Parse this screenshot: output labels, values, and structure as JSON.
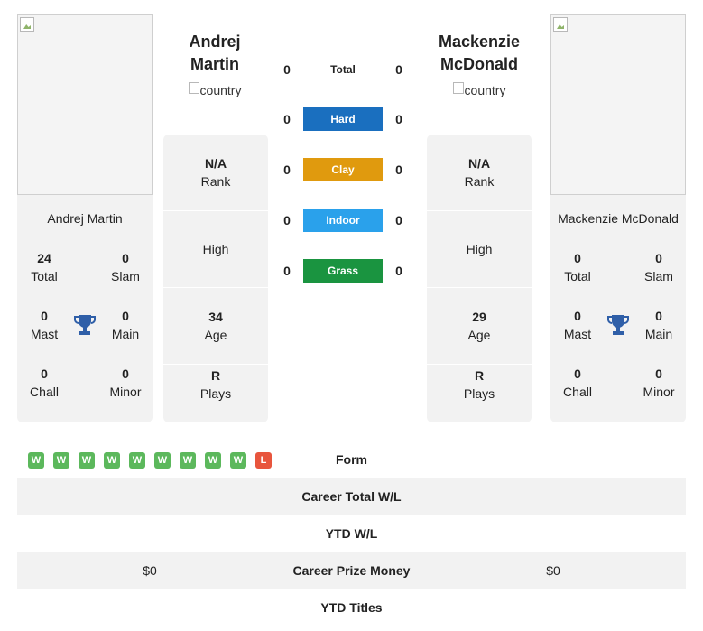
{
  "player1": {
    "name_line1": "Andrej",
    "name_line2": "Martin",
    "full_name": "Andrej Martin",
    "country_alt": "country",
    "stats": {
      "total": {
        "value": "24",
        "label": "Total"
      },
      "slam": {
        "value": "0",
        "label": "Slam"
      },
      "mast": {
        "value": "0",
        "label": "Mast"
      },
      "main": {
        "value": "0",
        "label": "Main"
      },
      "chall": {
        "value": "0",
        "label": "Chall"
      },
      "minor": {
        "value": "0",
        "label": "Minor"
      }
    },
    "rank": {
      "value": "N/A",
      "label": "Rank"
    },
    "high": {
      "label": "High"
    },
    "age": {
      "value": "34",
      "label": "Age"
    },
    "plays": {
      "value": "R",
      "label": "Plays"
    },
    "form": [
      "W",
      "W",
      "W",
      "W",
      "W",
      "W",
      "W",
      "W",
      "W",
      "L"
    ],
    "career_prize_money": "$0"
  },
  "player2": {
    "name_line1": "Mackenzie",
    "name_line2": "McDonald",
    "full_name": "Mackenzie McDonald",
    "country_alt": "country",
    "stats": {
      "total": {
        "value": "0",
        "label": "Total"
      },
      "slam": {
        "value": "0",
        "label": "Slam"
      },
      "mast": {
        "value": "0",
        "label": "Mast"
      },
      "main": {
        "value": "0",
        "label": "Main"
      },
      "chall": {
        "value": "0",
        "label": "Chall"
      },
      "minor": {
        "value": "0",
        "label": "Minor"
      }
    },
    "rank": {
      "value": "N/A",
      "label": "Rank"
    },
    "high": {
      "label": "High"
    },
    "age": {
      "value": "29",
      "label": "Age"
    },
    "plays": {
      "value": "R",
      "label": "Plays"
    },
    "career_prize_money": "$0"
  },
  "surfaces": [
    {
      "label": "Total",
      "p1": "0",
      "p2": "0",
      "color": ""
    },
    {
      "label": "Hard",
      "p1": "0",
      "p2": "0",
      "color": "#1a6fbf"
    },
    {
      "label": "Clay",
      "p1": "0",
      "p2": "0",
      "color": "#e09a0e"
    },
    {
      "label": "Indoor",
      "p1": "0",
      "p2": "0",
      "color": "#2aa1eb"
    },
    {
      "label": "Grass",
      "p1": "0",
      "p2": "0",
      "color": "#1a9440"
    }
  ],
  "table": {
    "form_label": "Form",
    "career_wl_label": "Career Total W/L",
    "ytd_wl_label": "YTD W/L",
    "prize_label": "Career Prize Money",
    "ytd_titles_label": "YTD Titles"
  },
  "colors": {
    "win": "#5cb85c",
    "loss": "#e8553d",
    "trophy": "#2f5fa8"
  }
}
